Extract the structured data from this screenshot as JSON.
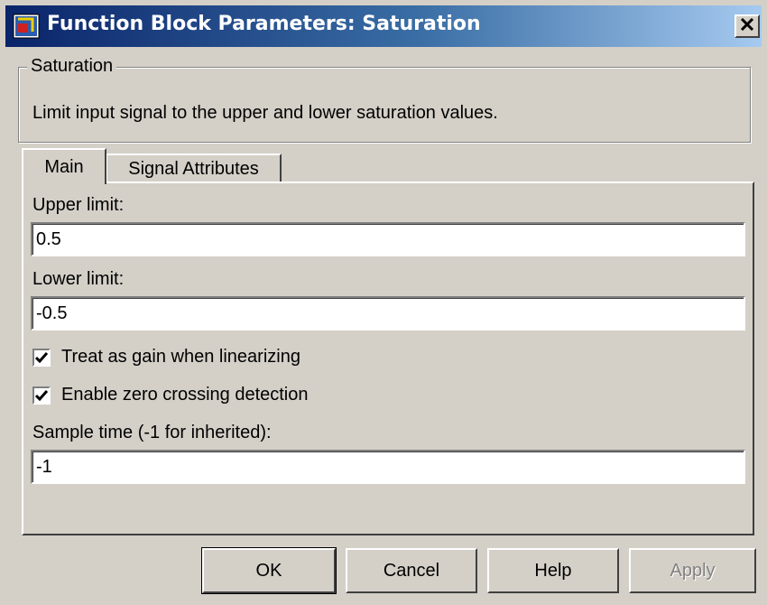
{
  "window": {
    "title": "Function Block Parameters: Saturation",
    "titlebar_colors": [
      "#0a246a",
      "#a6caf0"
    ]
  },
  "group": {
    "legend": "Saturation",
    "description": "Limit input signal to the upper and lower saturation values."
  },
  "tabs": [
    {
      "label": "Main",
      "selected": true
    },
    {
      "label": "Signal Attributes",
      "selected": false
    }
  ],
  "params": {
    "upper_limit_label": "Upper limit:",
    "upper_limit_value": "0.5",
    "lower_limit_label": "Lower limit:",
    "lower_limit_value": "-0.5",
    "treat_gain_label": "Treat as gain when linearizing",
    "treat_gain_checked": true,
    "zero_crossing_label": "Enable zero crossing detection",
    "zero_crossing_checked": true,
    "sample_time_label": "Sample time (-1 for inherited):",
    "sample_time_value": "-1"
  },
  "buttons": {
    "ok": "OK",
    "cancel": "Cancel",
    "help": "Help",
    "apply": "Apply"
  },
  "icons": {
    "app": "simulink-block-icon",
    "close": "close-icon",
    "check": "checkmark-icon"
  }
}
